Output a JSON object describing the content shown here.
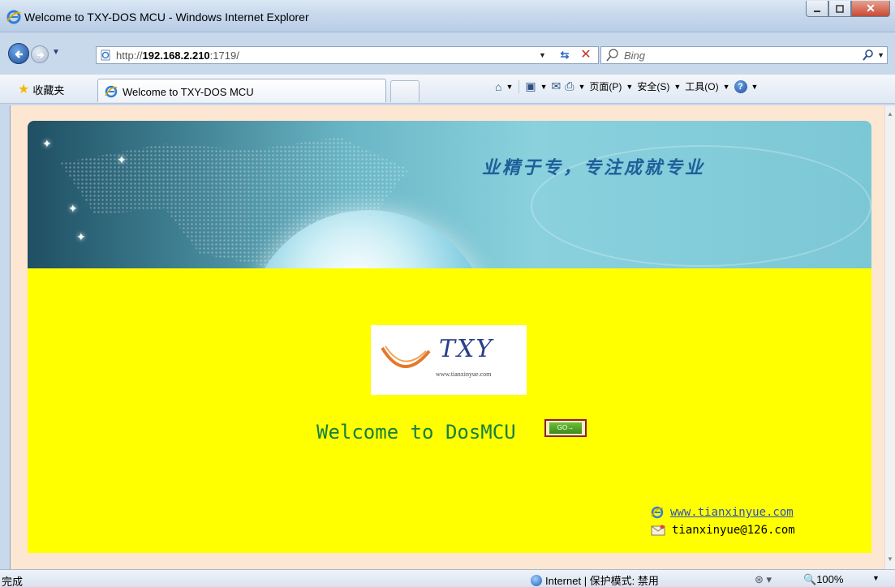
{
  "window": {
    "title": "Welcome to TXY-DOS MCU - Windows Internet Explorer"
  },
  "address_bar": {
    "url_prefix": "http://",
    "url_host": "192.168.2.210",
    "url_suffix": ":1719/",
    "search_placeholder": "Bing"
  },
  "command_bar": {
    "favorites_label": "收藏夹",
    "tab_label": "Welcome to TXY-DOS MCU",
    "page_menu": "页面(P)",
    "safety_menu": "安全(S)",
    "tools_menu": "工具(O)"
  },
  "banner": {
    "slogan": "业精于专，专注成就专业"
  },
  "page": {
    "logo_text": "TXY",
    "logo_url": "www.tianxinyue.com",
    "welcome_text": "Welcome to DosMCU",
    "go_label": "GO→",
    "website_link": "www.tianxinyue.com",
    "email": "tianxinyue@126.com"
  },
  "status_bar": {
    "status_text": "完成",
    "zone_text": "Internet | 保护模式: 禁用",
    "zoom_text": "100%"
  },
  "colors": {
    "panel_yellow": "#ffff00",
    "welcome_green": "#167f3f",
    "link_blue": "#2b4fbf"
  }
}
